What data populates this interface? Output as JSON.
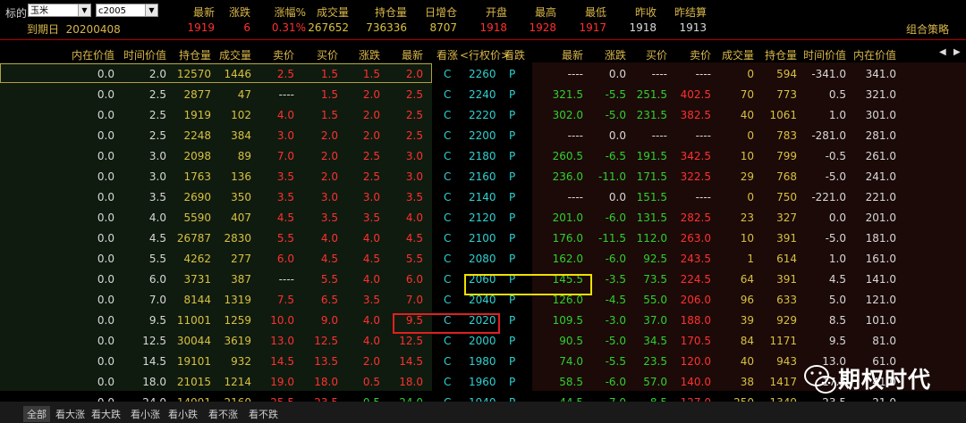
{
  "top": {
    "underlying_label": "标的",
    "underlying_value": "玉米",
    "contract_value": "c2005",
    "quote_headers": [
      "最新",
      "涨跌",
      "涨幅%",
      "成交量",
      "持仓量",
      "日增仓",
      "开盘",
      "最高",
      "最低",
      "昨收",
      "昨结算"
    ],
    "quote_values": [
      "1919",
      "6",
      "0.31%",
      "267652",
      "736336",
      "8707",
      "1918",
      "1928",
      "1917",
      "1918",
      "1913"
    ],
    "expire_label": "到期日",
    "expire_value": "20200408",
    "combo_label": "组合策略"
  },
  "headers": {
    "left": [
      "内在价值",
      "时间价值",
      "持仓量",
      "成交量",
      "卖价",
      "买价",
      "涨跌",
      "最新"
    ],
    "mid": [
      "看涨",
      "<行权价>",
      "看跌"
    ],
    "right": [
      "最新",
      "涨跌",
      "买价",
      "卖价",
      "成交量",
      "持仓量",
      "时间价值",
      "内在价值"
    ]
  },
  "rows": [
    {
      "c": [
        "0.0",
        "2.0",
        "12570",
        "1446",
        "2.5",
        "1.5",
        "1.5",
        "2.0"
      ],
      "strike": "2260",
      "p": [
        "----",
        "0.0",
        "----",
        "----",
        "0",
        "594",
        "-341.0",
        "341.0"
      ]
    },
    {
      "c": [
        "0.0",
        "2.5",
        "2877",
        "47",
        "----",
        "1.5",
        "2.0",
        "2.5"
      ],
      "strike": "2240",
      "p": [
        "321.5",
        "-5.5",
        "251.5",
        "402.5",
        "70",
        "773",
        "0.5",
        "321.0"
      ]
    },
    {
      "c": [
        "0.0",
        "2.5",
        "1919",
        "102",
        "4.0",
        "1.5",
        "2.0",
        "2.5"
      ],
      "strike": "2220",
      "p": [
        "302.0",
        "-5.0",
        "231.5",
        "382.5",
        "40",
        "1061",
        "1.0",
        "301.0"
      ]
    },
    {
      "c": [
        "0.0",
        "2.5",
        "2248",
        "384",
        "3.0",
        "2.0",
        "2.0",
        "2.5"
      ],
      "strike": "2200",
      "p": [
        "----",
        "0.0",
        "----",
        "----",
        "0",
        "783",
        "-281.0",
        "281.0"
      ]
    },
    {
      "c": [
        "0.0",
        "3.0",
        "2098",
        "89",
        "7.0",
        "2.0",
        "2.5",
        "3.0"
      ],
      "strike": "2180",
      "p": [
        "260.5",
        "-6.5",
        "191.5",
        "342.5",
        "10",
        "799",
        "-0.5",
        "261.0"
      ]
    },
    {
      "c": [
        "0.0",
        "3.0",
        "1763",
        "136",
        "3.5",
        "2.0",
        "2.5",
        "3.0"
      ],
      "strike": "2160",
      "p": [
        "236.0",
        "-11.0",
        "171.5",
        "322.5",
        "29",
        "768",
        "-5.0",
        "241.0"
      ]
    },
    {
      "c": [
        "0.0",
        "3.5",
        "2690",
        "350",
        "3.5",
        "3.0",
        "3.0",
        "3.5"
      ],
      "strike": "2140",
      "p": [
        "----",
        "0.0",
        "151.5",
        "----",
        "0",
        "750",
        "-221.0",
        "221.0"
      ]
    },
    {
      "c": [
        "0.0",
        "4.0",
        "5590",
        "407",
        "4.5",
        "3.5",
        "3.5",
        "4.0"
      ],
      "strike": "2120",
      "p": [
        "201.0",
        "-6.0",
        "131.5",
        "282.5",
        "23",
        "327",
        "0.0",
        "201.0"
      ]
    },
    {
      "c": [
        "0.0",
        "4.5",
        "26787",
        "2830",
        "5.5",
        "4.0",
        "4.0",
        "4.5"
      ],
      "strike": "2100",
      "p": [
        "176.0",
        "-11.5",
        "112.0",
        "263.0",
        "10",
        "391",
        "-5.0",
        "181.0"
      ]
    },
    {
      "c": [
        "0.0",
        "5.5",
        "4262",
        "277",
        "6.0",
        "4.5",
        "4.5",
        "5.5"
      ],
      "strike": "2080",
      "p": [
        "162.0",
        "-6.0",
        "92.5",
        "243.5",
        "1",
        "614",
        "1.0",
        "161.0"
      ]
    },
    {
      "c": [
        "0.0",
        "6.0",
        "3731",
        "387",
        "----",
        "5.5",
        "4.0",
        "6.0"
      ],
      "strike": "2060",
      "p": [
        "145.5",
        "-3.5",
        "73.5",
        "224.5",
        "64",
        "391",
        "4.5",
        "141.0"
      ]
    },
    {
      "c": [
        "0.0",
        "7.0",
        "8144",
        "1319",
        "7.5",
        "6.5",
        "3.5",
        "7.0"
      ],
      "strike": "2040",
      "p": [
        "126.0",
        "-4.5",
        "55.0",
        "206.0",
        "96",
        "633",
        "5.0",
        "121.0"
      ]
    },
    {
      "c": [
        "0.0",
        "9.5",
        "11001",
        "1259",
        "10.0",
        "9.0",
        "4.0",
        "9.5"
      ],
      "strike": "2020",
      "p": [
        "109.5",
        "-3.0",
        "37.0",
        "188.0",
        "39",
        "929",
        "8.5",
        "101.0"
      ]
    },
    {
      "c": [
        "0.0",
        "12.5",
        "30044",
        "3619",
        "13.0",
        "12.5",
        "4.0",
        "12.5"
      ],
      "strike": "2000",
      "p": [
        "90.5",
        "-5.0",
        "34.5",
        "170.5",
        "84",
        "1171",
        "9.5",
        "81.0"
      ]
    },
    {
      "c": [
        "0.0",
        "14.5",
        "19101",
        "932",
        "14.5",
        "13.5",
        "2.0",
        "14.5"
      ],
      "strike": "1980",
      "p": [
        "74.0",
        "-5.5",
        "23.5",
        "120.0",
        "40",
        "943",
        "13.0",
        "61.0"
      ]
    },
    {
      "c": [
        "0.0",
        "18.0",
        "21015",
        "1214",
        "19.0",
        "18.0",
        "0.5",
        "18.0"
      ],
      "strike": "1960",
      "p": [
        "58.5",
        "-6.0",
        "57.0",
        "140.0",
        "38",
        "1417",
        "17.5",
        "41.0"
      ]
    },
    {
      "c": [
        "0.0",
        "24.0",
        "14991",
        "2160",
        "25.5",
        "23.5",
        "-0.5",
        "24.0"
      ],
      "strike": "1940",
      "p": [
        "44.5",
        "-7.0",
        "8.5",
        "127.0",
        "250",
        "1349",
        "23.5",
        "21.0"
      ]
    }
  ],
  "call_letter": "C",
  "put_letter": "P",
  "bottom_tabs": [
    "全部",
    "看大涨",
    "看大跌",
    "看小涨",
    "看小跌",
    "看不涨",
    "看不跌"
  ],
  "watermark": "期权时代",
  "colors": {
    "up": "#ff3030",
    "down": "#30d030",
    "neutral": "#d8d8d8",
    "volume": "#d8c040",
    "header": "#d8b64a",
    "strike": "#30d0d0",
    "highlight_yellow": "#f0e000",
    "highlight_red": "#e02020"
  }
}
